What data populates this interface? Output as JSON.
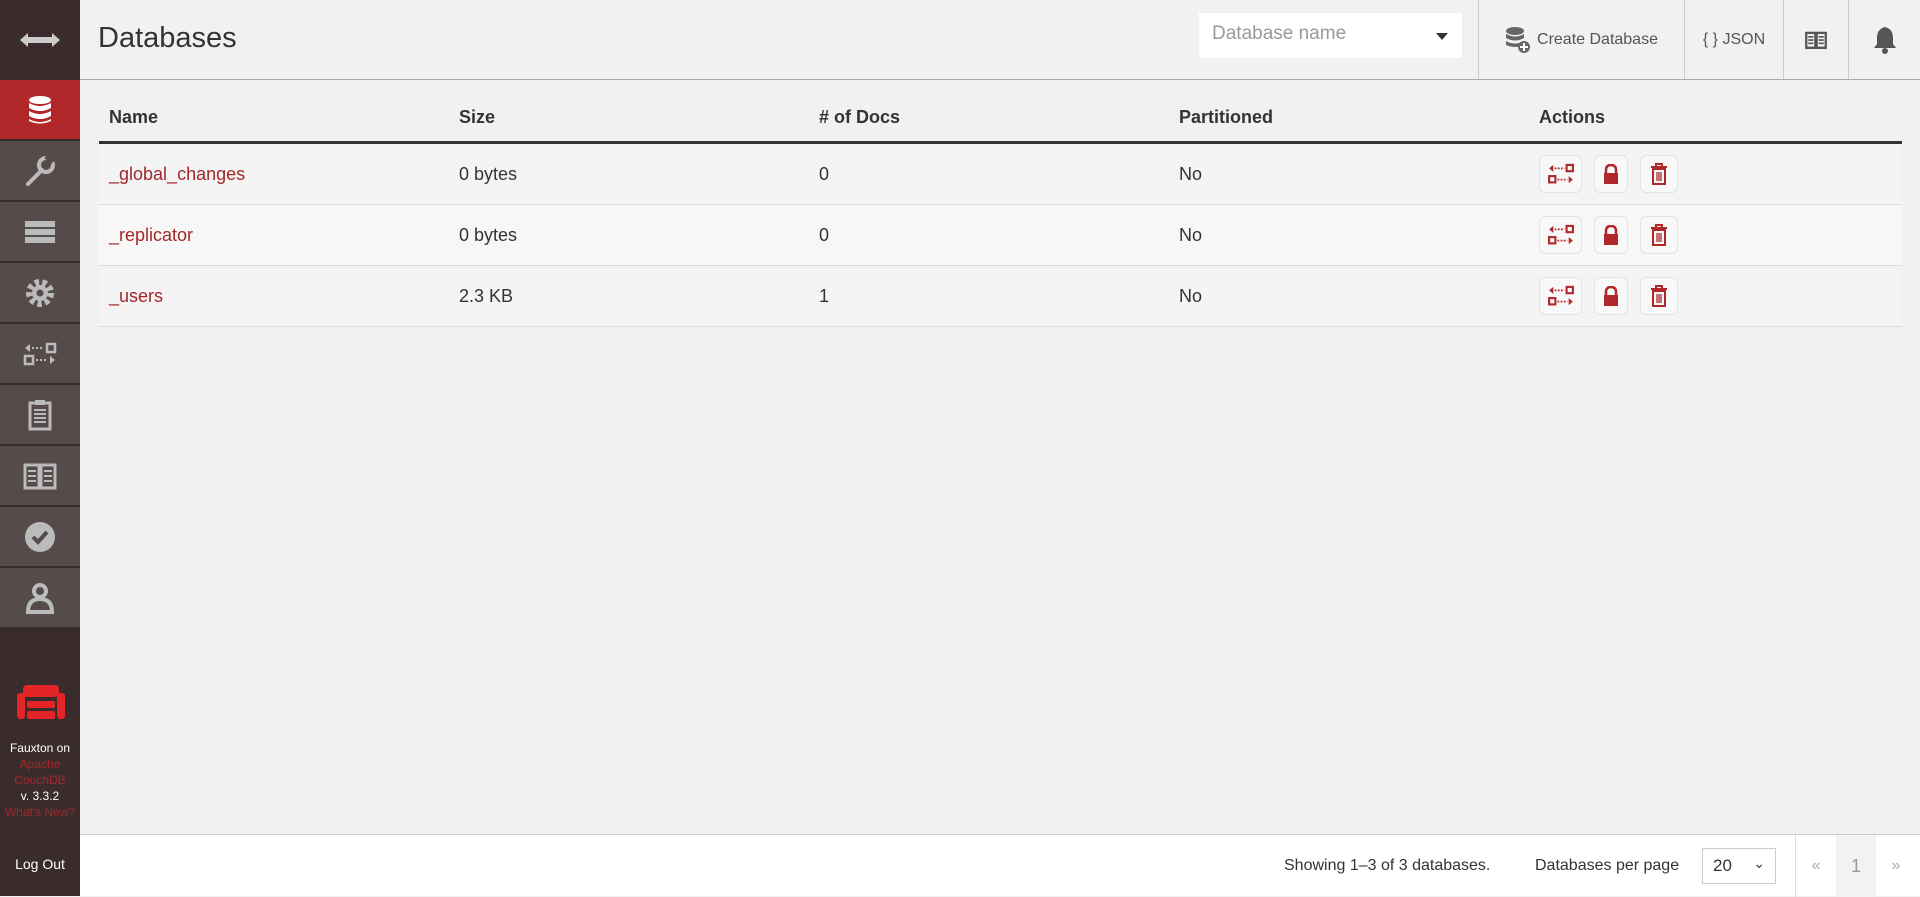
{
  "sidebar": {
    "items": [
      {
        "name": "databases",
        "icon": "database-icon",
        "active": true
      },
      {
        "name": "setup",
        "icon": "wrench-icon"
      },
      {
        "name": "active-tasks",
        "icon": "server-icon"
      },
      {
        "name": "config",
        "icon": "gear-icon"
      },
      {
        "name": "replication",
        "icon": "replication-icon"
      },
      {
        "name": "logs",
        "icon": "clipboard-icon"
      },
      {
        "name": "documentation",
        "icon": "book-icon"
      },
      {
        "name": "verify",
        "icon": "check-circle-icon"
      },
      {
        "name": "user",
        "icon": "user-icon"
      }
    ],
    "brand": {
      "line1": "Fauxton on",
      "line2": "Apache",
      "line3": "CouchDB",
      "version": "v. 3.3.2",
      "whats_new": "What's New?"
    },
    "logout": "Log Out"
  },
  "header": {
    "title": "Databases",
    "search_placeholder": "Database name",
    "create_label": "Create Database",
    "json_label": "{ } JSON"
  },
  "table": {
    "columns": [
      "Name",
      "Size",
      "# of Docs",
      "Partitioned",
      "Actions"
    ],
    "rows": [
      {
        "name": "_global_changes",
        "size": "0 bytes",
        "docs": "0",
        "partitioned": "No"
      },
      {
        "name": "_replicator",
        "size": "0 bytes",
        "docs": "0",
        "partitioned": "No"
      },
      {
        "name": "_users",
        "size": "2.3 KB",
        "docs": "1",
        "partitioned": "No"
      }
    ]
  },
  "footer": {
    "showing": "Showing 1–3 of 3 databases.",
    "per_page_label": "Databases per page",
    "per_page": "20",
    "prev": "«",
    "page": "1",
    "next": "»"
  },
  "colors": {
    "accent": "#b0282a",
    "sidebar": "#3a2c2c",
    "link": "#a2282a"
  }
}
